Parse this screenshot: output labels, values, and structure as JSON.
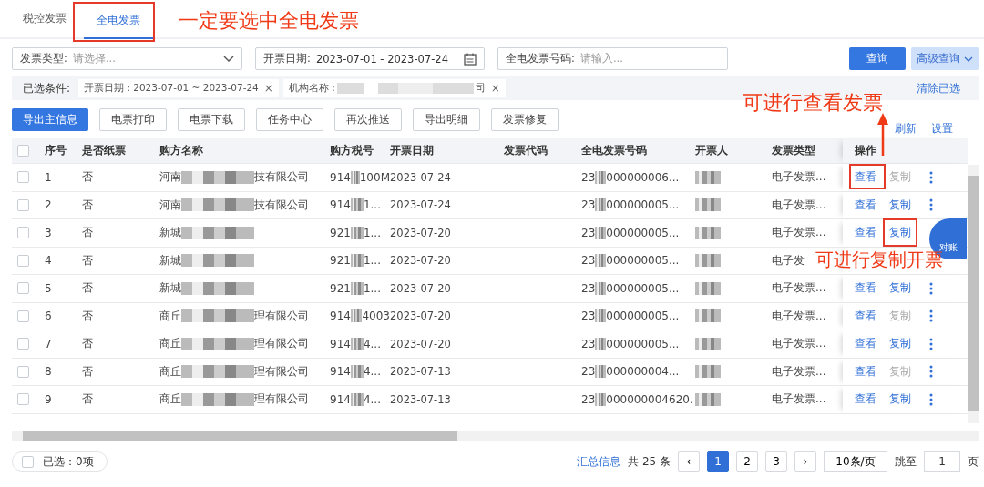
{
  "tabs": [
    {
      "label": "税控发票",
      "selected": false
    },
    {
      "label": "全电发票",
      "selected": true
    }
  ],
  "filters": [
    {
      "kind": "select",
      "label": "发票类型:",
      "placeholder": "请选择..."
    },
    {
      "kind": "date",
      "label": "开票日期:",
      "value": "2023-07-01 - 2023-07-24"
    },
    {
      "kind": "text",
      "label": "全电发票号码:",
      "placeholder": "请输入..."
    }
  ],
  "search_button": "查询",
  "advanced_button": "高级查询",
  "conditions": {
    "label": "已选条件:",
    "chips": [
      {
        "text": "开票日期 : 2023-07-01 ~ 2023-07-24",
        "close": "×"
      },
      {
        "text": "机构名称 :",
        "tail": "司",
        "close": "×"
      }
    ],
    "clear": "清除已选"
  },
  "actions": [
    {
      "label": "导出主信息",
      "primary": true
    },
    {
      "label": "电票打印",
      "primary": false
    },
    {
      "label": "电票下载",
      "primary": false
    },
    {
      "label": "任务中心",
      "primary": false
    },
    {
      "label": "再次推送",
      "primary": false
    },
    {
      "label": "导出明细",
      "primary": false
    },
    {
      "label": "发票修复",
      "primary": false
    }
  ],
  "table_links": [
    "刷新",
    "设置"
  ],
  "table": {
    "select_all_checked": false,
    "columns": [
      "序号",
      "是否纸票",
      "购方名称",
      "购方税号",
      "开票日期",
      "发票代码",
      "全电发票号码",
      "开票人",
      "发票类型",
      "操作"
    ],
    "rows": [
      {
        "no": "1",
        "paper": "否",
        "name_start": "河南",
        "name_end": "技有限公司",
        "tax_start": "914",
        "tax_end": "100M",
        "date": "2023-07-24",
        "number_start": "23",
        "number_end": "000000006...",
        "type": "电子发票...",
        "view": "查看",
        "copy": "复制",
        "copy_disabled": true,
        "more": true,
        "checked": false
      },
      {
        "no": "2",
        "paper": "否",
        "name_start": "河南",
        "name_end": "技有限公司",
        "tax_start": "914",
        "tax_end": "1...",
        "date": "2023-07-24",
        "number_start": "23",
        "number_end": "000000005...",
        "type": "电子发票...",
        "view": "查看",
        "copy": "复制",
        "copy_disabled": false,
        "more": true,
        "checked": false
      },
      {
        "no": "3",
        "paper": "否",
        "name_start": "新城",
        "tax_start": "921",
        "tax_end": "1...",
        "date": "2023-07-20",
        "number_start": "23",
        "number_end": "000000005...",
        "type": "电子发票...",
        "view": "查看",
        "copy": "复制",
        "copy_disabled": false,
        "more": false,
        "checked": false
      },
      {
        "no": "4",
        "paper": "否",
        "name_start": "新城",
        "tax_start": "921",
        "tax_end": "1...",
        "date": "2023-07-20",
        "number_start": "23",
        "number_end": "000000005...",
        "type": "电子发",
        "more": false,
        "checked": false
      },
      {
        "no": "5",
        "paper": "否",
        "name_start": "新城",
        "tax_start": "921",
        "tax_end": "1...",
        "date": "2023-07-20",
        "number_start": "23",
        "number_end": "000000005...",
        "type": "电子发票...",
        "view": "查看",
        "copy": "复制",
        "copy_disabled": false,
        "more": true,
        "checked": false
      },
      {
        "no": "6",
        "paper": "否",
        "name_start": "商丘",
        "name_end": "理有限公司",
        "tax_start": "914",
        "tax_end": "4003",
        "date": "2023-07-20",
        "number_start": "23",
        "number_end": "000000005...",
        "type": "电子发票...",
        "view": "查看",
        "copy": "复制",
        "copy_disabled": true,
        "more": true,
        "checked": false
      },
      {
        "no": "7",
        "paper": "否",
        "name_start": "商丘",
        "name_end": "理有限公司",
        "tax_start": "914",
        "tax_end": "4...",
        "date": "2023-07-20",
        "number_start": "23",
        "number_end": "000000005...",
        "type": "电子发票...",
        "view": "查看",
        "copy": "复制",
        "copy_disabled": false,
        "more": true,
        "checked": false
      },
      {
        "no": "8",
        "paper": "否",
        "name_start": "商丘",
        "name_end": "理有限公司",
        "tax_start": "914",
        "tax_end": "4...",
        "date": "2023-07-13",
        "number_start": "23",
        "number_end": "000000004...",
        "type": "电子发票...",
        "view": "查看",
        "copy": "复制",
        "copy_disabled": true,
        "more": true,
        "checked": false
      },
      {
        "no": "9",
        "paper": "否",
        "name_start": "商丘",
        "name_end": "理有限公司",
        "tax_start": "914",
        "tax_end": "4...",
        "date": "2023-07-13",
        "number_start": "23",
        "number_end": "000000004620.",
        "type": "电子发票...",
        "view": "查看",
        "copy": "复制",
        "copy_disabled": false,
        "more": true,
        "checked": false
      }
    ]
  },
  "float_button": "对账",
  "footer": {
    "checked": false,
    "selected": "已选：0项",
    "summary": "汇总信息",
    "total": "共 25 条",
    "prev": "‹",
    "pages": [
      {
        "label": "1",
        "selected": true
      },
      {
        "label": "2",
        "selected": false
      },
      {
        "label": "3",
        "selected": false
      }
    ],
    "next": "›",
    "page_size": "10条/页",
    "jump_label": "跳至",
    "jump_value": "1",
    "page_unit": "页"
  },
  "annotations": [
    {
      "kind": "frame"
    },
    {
      "kind": "label",
      "text": "一定要选中全电发票"
    },
    {
      "kind": "label",
      "text": "可进行查看发票"
    },
    {
      "kind": "arrow"
    },
    {
      "kind": "frame"
    },
    {
      "kind": "frame"
    },
    {
      "kind": "label",
      "text": "可进行复制开票"
    }
  ]
}
